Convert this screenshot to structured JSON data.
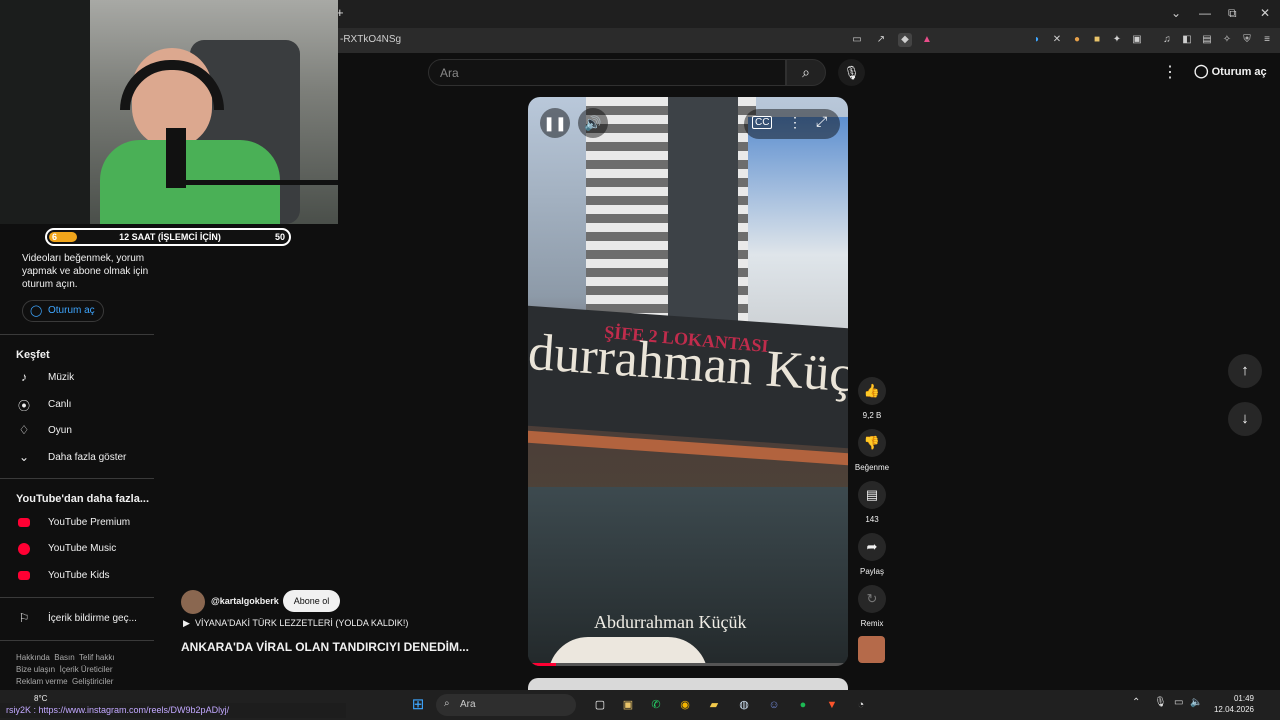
{
  "browser": {
    "new_tab": "+",
    "url": "-RXTkO4NSg",
    "window_controls": [
      "⌄",
      "—",
      "⧉",
      "✕"
    ]
  },
  "header": {
    "search_placeholder": "Ara",
    "signin": "Oturum aç"
  },
  "overlay": {
    "progress_start": "6",
    "progress_label": "12 SAAT (İŞLEMCİ İÇİN)",
    "progress_end": "50",
    "progress_fraction": 0.05
  },
  "sidebar": {
    "signin_prompt_1": "Videoları beğenmek, yorum",
    "signin_prompt_2": "yapmak ve abone olmak için",
    "signin_prompt_3": "oturum açın.",
    "signin_button": "Oturum aç",
    "explore_title": "Keşfet",
    "explore_items": [
      {
        "label": "Müzik",
        "icon": "music-note-icon"
      },
      {
        "label": "Canlı",
        "icon": "live-icon"
      },
      {
        "label": "Oyun",
        "icon": "gaming-icon"
      },
      {
        "label": "Daha fazla göster",
        "icon": "chevron-down-icon"
      }
    ],
    "more_title": "YouTube'dan daha fazla...",
    "more_items": [
      {
        "label": "YouTube Premium"
      },
      {
        "label": "YouTube Music"
      },
      {
        "label": "YouTube Kids"
      }
    ],
    "report_label": "İçerik bildirme geç...",
    "footer_line1": [
      "Hakkında",
      "Basın",
      "Telif hakkı"
    ],
    "footer_line2": [
      "Bize ulaşın",
      "İçerik Üreticiler"
    ],
    "footer_line3": [
      "Reklam verme",
      "Geliştiriciler"
    ],
    "brand_color": "#ff0033"
  },
  "short": {
    "sign_text": "durrahman Küçü",
    "sign_sub": "ŞİFE 2 LOKANTASI",
    "store_text": "Abdurrahman Küçük",
    "likes": "9,2 B",
    "dislike_label": "Beğenme",
    "comments": "143",
    "share_label": "Paylaş",
    "remix_label": "Remix"
  },
  "channel": {
    "handle": "@kartalgokberk",
    "subscribe": "Abone ol",
    "playlist": "VİYANA'DAKİ TÜRK LEZZETLERİ (YOLDA KALDIK!)",
    "title": "ANKARA'DA VİRAL OLAN TANDIRCIYI DENEDİM..."
  },
  "status_link": "rsiy2K : https://www.instagram.com/reels/DW9b2pADlyj/",
  "taskbar": {
    "weather": "8°C",
    "search": "Ara",
    "time": "01:49",
    "date": "12.04.2026"
  }
}
